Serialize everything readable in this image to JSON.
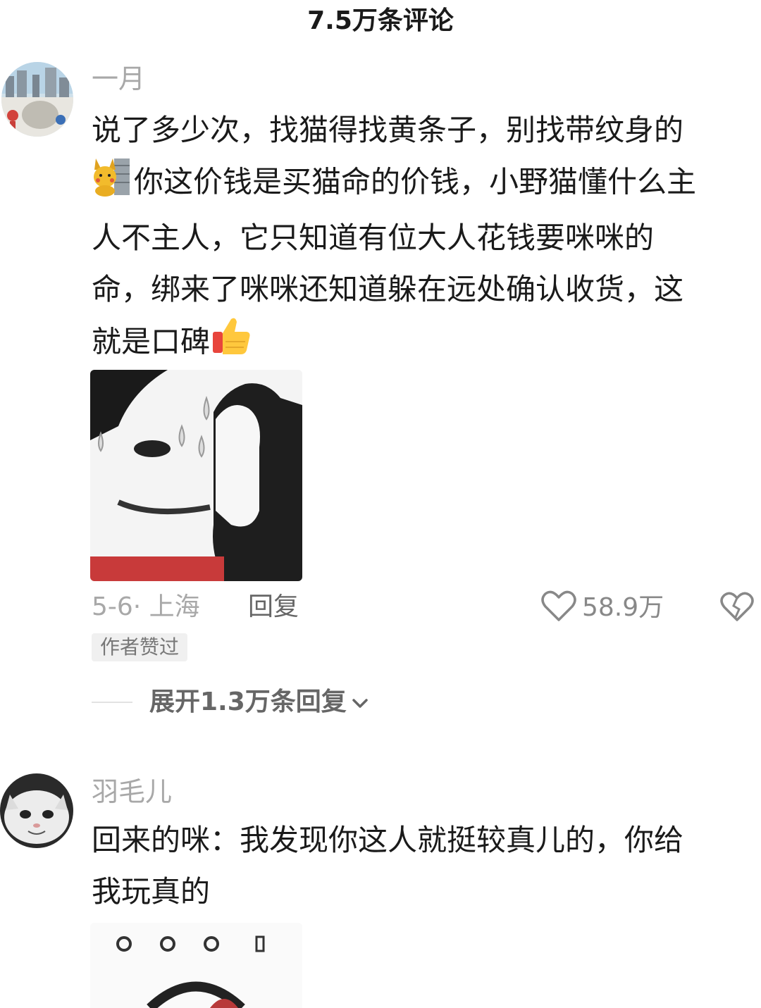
{
  "header": {
    "title": "7.5万条评论"
  },
  "comments": [
    {
      "username": "一月",
      "text_lines": [
        "说了多少次，找猫得找黄条子，别找带纹身的",
        "你这价钱是买猫命的价钱，小野猫懂什么主",
        "人不主人，它只知道有位大人花钱要咪咪的",
        "命，绑来了咪咪还知道躲在远处确认收货，这",
        "就是口碑"
      ],
      "date_location": "5-6· 上海",
      "reply_label": "回复",
      "like_count": "58.9万",
      "author_badge": "作者赞过",
      "expand_label": "展开1.3万条回复"
    },
    {
      "username": "羽毛儿",
      "text_lines": [
        "回来的咪：我发现你这人就挺较真儿的，你给",
        "我玩真的"
      ]
    }
  ],
  "icons": {
    "heart": "heart-icon",
    "broken_heart": "broken-heart-icon",
    "chevron": "chevron-down-icon",
    "pikachu_emoji": "pikachu-emoji-icon",
    "thumbs_up_emoji": "thumbs-up-emoji-icon"
  }
}
